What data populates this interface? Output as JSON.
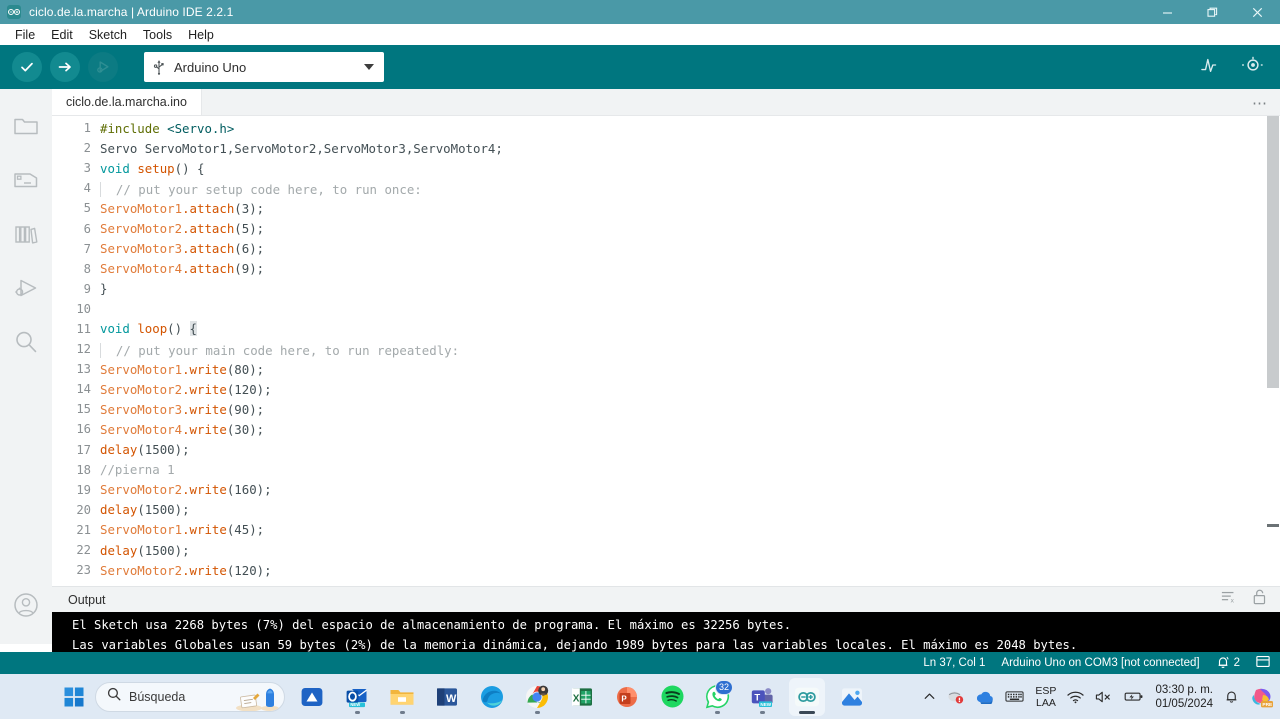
{
  "window": {
    "title": "ciclo.de.la.marcha | Arduino IDE 2.2.1",
    "minimize_label": "—",
    "maximize_label": "❐",
    "close_label": "×"
  },
  "menubar": {
    "items": [
      {
        "label": "File"
      },
      {
        "label": "Edit"
      },
      {
        "label": "Sketch"
      },
      {
        "label": "Tools"
      },
      {
        "label": "Help"
      }
    ]
  },
  "toolbar": {
    "verify_tooltip": "Verify",
    "upload_tooltip": "Upload",
    "debug_tooltip": "Debug",
    "board_selector": {
      "value": "Arduino Uno",
      "usb_icon": "usb-icon",
      "caret_icon": "chevron-down-icon"
    },
    "serial_plotter_icon": "serial-plotter-icon",
    "serial_monitor_icon": "serial-monitor-icon"
  },
  "activitybar": {
    "items": [
      {
        "name": "sketchbook",
        "icon": "folder-icon"
      },
      {
        "name": "boards-manager",
        "icon": "boards-icon"
      },
      {
        "name": "library-manager",
        "icon": "books-icon"
      },
      {
        "name": "debug",
        "icon": "debug-icon"
      },
      {
        "name": "search",
        "icon": "search-icon"
      }
    ],
    "account_icon": "account-circle-icon"
  },
  "editor": {
    "tab_label": "ciclo.de.la.marcha.ino",
    "more_label": "⋯",
    "lines": [
      {
        "n": "1",
        "tokens": [
          {
            "t": "#include ",
            "c": "pre"
          },
          {
            "t": "<Servo.h>",
            "c": "str"
          }
        ]
      },
      {
        "n": "2",
        "tokens": [
          {
            "t": "Servo ServoMotor1,ServoMotor2,ServoMotor3,ServoMotor4;",
            "c": "pun"
          }
        ]
      },
      {
        "n": "3",
        "tokens": [
          {
            "t": "void ",
            "c": "kw"
          },
          {
            "t": "setup",
            "c": "fn"
          },
          {
            "t": "() {",
            "c": "pun"
          }
        ]
      },
      {
        "n": "4",
        "indent": true,
        "tokens": [
          {
            "t": "  // put your setup code here, to run once:",
            "c": "com"
          }
        ]
      },
      {
        "n": "5",
        "tokens": [
          {
            "t": "ServoMotor1",
            "c": "id"
          },
          {
            "t": ".attach",
            "c": "fn"
          },
          {
            "t": "(3);",
            "c": "pun"
          }
        ]
      },
      {
        "n": "6",
        "tokens": [
          {
            "t": "ServoMotor2",
            "c": "id"
          },
          {
            "t": ".attach",
            "c": "fn"
          },
          {
            "t": "(5);",
            "c": "pun"
          }
        ]
      },
      {
        "n": "7",
        "tokens": [
          {
            "t": "ServoMotor3",
            "c": "id"
          },
          {
            "t": ".attach",
            "c": "fn"
          },
          {
            "t": "(6);",
            "c": "pun"
          }
        ]
      },
      {
        "n": "8",
        "tokens": [
          {
            "t": "ServoMotor4",
            "c": "id"
          },
          {
            "t": ".attach",
            "c": "fn"
          },
          {
            "t": "(9);",
            "c": "pun"
          }
        ]
      },
      {
        "n": "9",
        "tokens": [
          {
            "t": "}",
            "c": "pun"
          }
        ]
      },
      {
        "n": "10",
        "tokens": [
          {
            "t": "",
            "c": "pun"
          }
        ]
      },
      {
        "n": "11",
        "tokens": [
          {
            "t": "void ",
            "c": "kw"
          },
          {
            "t": "loop",
            "c": "fn"
          },
          {
            "t": "() ",
            "c": "pun"
          },
          {
            "t": "{",
            "c": "hl"
          }
        ]
      },
      {
        "n": "12",
        "indent": true,
        "tokens": [
          {
            "t": "  // put your main code here, to run repeatedly:",
            "c": "com"
          }
        ]
      },
      {
        "n": "13",
        "tokens": [
          {
            "t": "ServoMotor1",
            "c": "id"
          },
          {
            "t": ".write",
            "c": "fn"
          },
          {
            "t": "(80);",
            "c": "pun"
          }
        ]
      },
      {
        "n": "14",
        "tokens": [
          {
            "t": "ServoMotor2",
            "c": "id"
          },
          {
            "t": ".write",
            "c": "fn"
          },
          {
            "t": "(120);",
            "c": "pun"
          }
        ]
      },
      {
        "n": "15",
        "tokens": [
          {
            "t": "ServoMotor3",
            "c": "id"
          },
          {
            "t": ".write",
            "c": "fn"
          },
          {
            "t": "(90);",
            "c": "pun"
          }
        ]
      },
      {
        "n": "16",
        "tokens": [
          {
            "t": "ServoMotor4",
            "c": "id"
          },
          {
            "t": ".write",
            "c": "fn"
          },
          {
            "t": "(30);",
            "c": "pun"
          }
        ]
      },
      {
        "n": "17",
        "tokens": [
          {
            "t": "delay",
            "c": "fn"
          },
          {
            "t": "(1500);",
            "c": "pun"
          }
        ]
      },
      {
        "n": "18",
        "tokens": [
          {
            "t": "//pierna 1",
            "c": "com"
          }
        ]
      },
      {
        "n": "19",
        "tokens": [
          {
            "t": "ServoMotor2",
            "c": "id"
          },
          {
            "t": ".write",
            "c": "fn"
          },
          {
            "t": "(160);",
            "c": "pun"
          }
        ]
      },
      {
        "n": "20",
        "tokens": [
          {
            "t": "delay",
            "c": "fn"
          },
          {
            "t": "(1500);",
            "c": "pun"
          }
        ]
      },
      {
        "n": "21",
        "tokens": [
          {
            "t": "ServoMotor1",
            "c": "id"
          },
          {
            "t": ".write",
            "c": "fn"
          },
          {
            "t": "(45);",
            "c": "pun"
          }
        ]
      },
      {
        "n": "22",
        "tokens": [
          {
            "t": "delay",
            "c": "fn"
          },
          {
            "t": "(1500);",
            "c": "pun"
          }
        ]
      },
      {
        "n": "23",
        "tokens": [
          {
            "t": "ServoMotor2",
            "c": "id"
          },
          {
            "t": ".write",
            "c": "fn"
          },
          {
            "t": "(120);",
            "c": "pun"
          }
        ]
      }
    ]
  },
  "output": {
    "title": "Output",
    "clear_icon": "clear-output-icon",
    "autoscroll_icon": "lock-icon",
    "lines": [
      "El Sketch usa 2268 bytes (7%) del espacio de almacenamiento de programa. El máximo es 32256 bytes.",
      "Las variables Globales usan 59 bytes (2%) de la memoria dinámica, dejando 1989 bytes para las variables locales. El máximo es 2048 bytes."
    ]
  },
  "statusbar": {
    "cursor": "Ln 37, Col 1",
    "board": "Arduino Uno on COM3 [not connected]",
    "notifications_icon": "bell-icon",
    "notifications_count": "2",
    "panel_icon": "panel-toggle-icon"
  },
  "taskbar": {
    "start_icon": "windows-start-icon",
    "search": {
      "placeholder": "Búsqueda",
      "icon": "search-icon"
    },
    "apps": [
      {
        "name": "snipping-tool",
        "icon": "snip-icon",
        "running": false,
        "badge": ""
      },
      {
        "name": "outlook-new",
        "icon": "outlook-icon",
        "running": true,
        "badge": ""
      },
      {
        "name": "file-explorer",
        "icon": "folder-icon",
        "running": true,
        "badge": ""
      },
      {
        "name": "word",
        "icon": "word-icon",
        "running": false,
        "badge": ""
      },
      {
        "name": "edge",
        "icon": "edge-icon",
        "running": false,
        "badge": ""
      },
      {
        "name": "chrome",
        "icon": "chrome-icon",
        "running": true,
        "badge": ""
      },
      {
        "name": "excel",
        "icon": "excel-icon",
        "running": false,
        "badge": ""
      },
      {
        "name": "powerpoint",
        "icon": "powerpoint-icon",
        "running": false,
        "badge": ""
      },
      {
        "name": "spotify",
        "icon": "spotify-icon",
        "running": false,
        "badge": ""
      },
      {
        "name": "whatsapp",
        "icon": "whatsapp-icon",
        "running": true,
        "badge": "32"
      },
      {
        "name": "teams",
        "icon": "teams-icon",
        "running": true,
        "badge": ""
      },
      {
        "name": "arduino-ide",
        "icon": "arduino-icon",
        "running": true,
        "badge": "",
        "active": true
      },
      {
        "name": "photos",
        "icon": "photos-icon",
        "running": false,
        "badge": ""
      }
    ],
    "tray": {
      "overflow_icon": "chevron-up-icon",
      "antivirus_icon": "antivirus-icon",
      "onedrive_icon": "onedrive-icon",
      "keyboard_icon": "keyboard-icon",
      "language_line1": "ESP",
      "language_line2": "LAA",
      "wifi_icon": "wifi-icon",
      "volume_icon": "volume-muted-icon",
      "battery_icon": "battery-charging-icon",
      "time": "03:30 p. m.",
      "date": "01/05/2024",
      "bell_icon": "bell-icon",
      "copilot_icon": "copilot-icon",
      "copilot_badge": "PRE"
    }
  },
  "colors": {
    "teal": "#00767f",
    "teal_light": "#4a99a7",
    "accent_circle": "#128a90",
    "output_bg": "#000000",
    "taskbar_bg": "#dfe9f4"
  }
}
